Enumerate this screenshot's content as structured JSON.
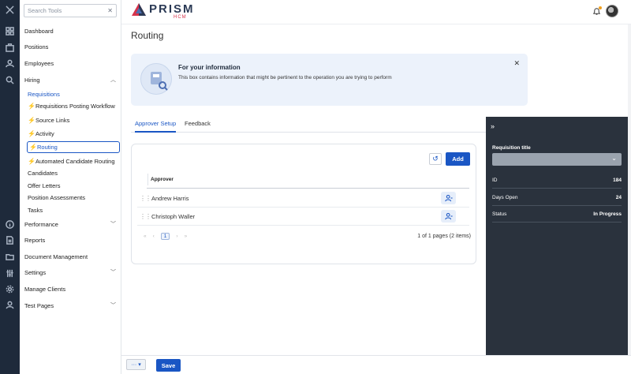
{
  "app": {
    "logo_text": "PRISM",
    "logo_sub": "HCM"
  },
  "rail": {
    "icons": [
      "close-icon",
      "dashboard-icon",
      "briefcase-icon",
      "user-icon",
      "hiring-icon",
      "info-icon",
      "document-icon",
      "folder-icon",
      "settings-sliders-icon",
      "gear-icon",
      "person-icon"
    ]
  },
  "sidebar": {
    "search_placeholder": "Search Tools",
    "items": [
      {
        "label": "Dashboard"
      },
      {
        "label": "Positions"
      },
      {
        "label": "Employees"
      },
      {
        "label": "Hiring",
        "chevron": "^"
      },
      {
        "label": "Requisitions"
      },
      {
        "label": "Requisitions Posting Workflow"
      },
      {
        "label": "Source Links"
      },
      {
        "label": "Activity"
      },
      {
        "label": "Routing"
      },
      {
        "label": "Automated Candidate Routing"
      },
      {
        "label": "Candidates"
      },
      {
        "label": "Offer Letters"
      },
      {
        "label": "Position Assessments"
      },
      {
        "label": "Tasks"
      },
      {
        "label": "Performance",
        "chevron": "v"
      },
      {
        "label": "Reports"
      },
      {
        "label": "Document Management"
      },
      {
        "label": "Settings",
        "chevron": "v"
      },
      {
        "label": "Manage Clients"
      },
      {
        "label": "Test Pages",
        "chevron": "v"
      }
    ]
  },
  "main": {
    "title": "Routing",
    "info_box": {
      "title": "For your information",
      "body": "This box contains information that might be pertinent to the operation you are trying to perform"
    },
    "tabs": [
      {
        "label": "Approver Setup",
        "active": true
      },
      {
        "label": "Feedback",
        "active": false
      }
    ],
    "grid": {
      "add_label": "Add",
      "column": "Approver",
      "rows": [
        {
          "name": "Andrew Harris"
        },
        {
          "name": "Christoph Waller"
        }
      ],
      "current_page": "1",
      "page_info": "1 of 1 pages (2 items)"
    }
  },
  "panel": {
    "requisition_title_label": "Requisition title",
    "fields": [
      {
        "label": "ID",
        "value": "184"
      },
      {
        "label": "Days Open",
        "value": "24"
      },
      {
        "label": "Status",
        "value": "In Progress"
      }
    ]
  },
  "footer": {
    "more_label": "···",
    "save_label": "Save"
  },
  "colors": {
    "accent": "#1a56c4",
    "rail_bg": "#1e2a3b",
    "panel_bg": "#2a323d",
    "info_bg": "#ecf2fb"
  }
}
